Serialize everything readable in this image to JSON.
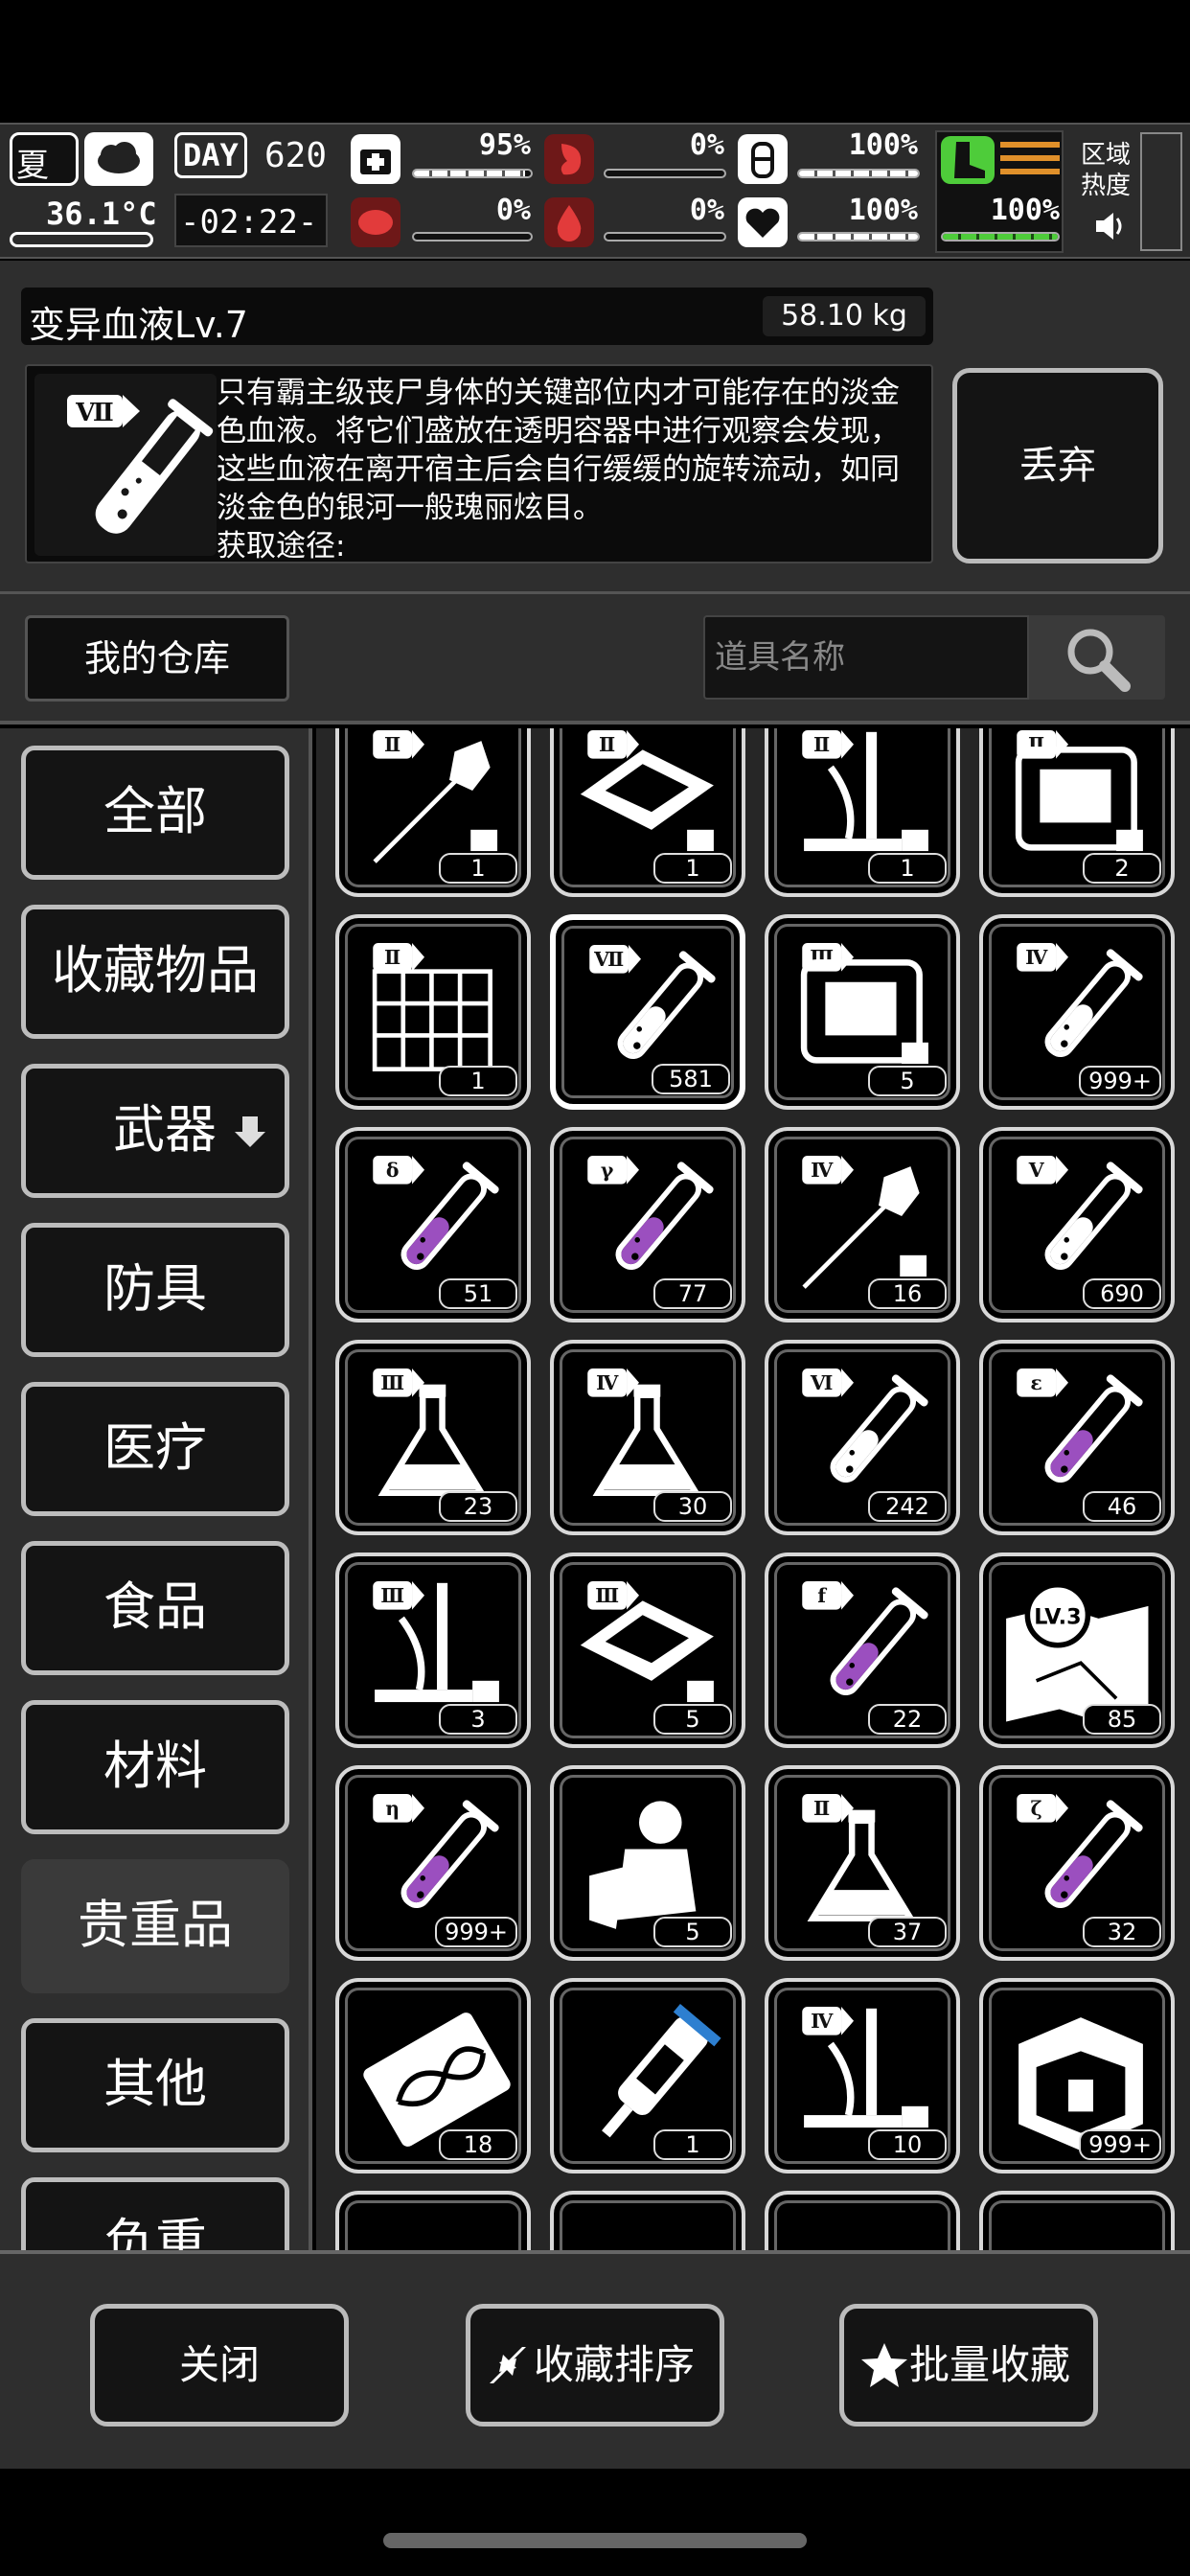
{
  "hud": {
    "season": "夏",
    "day_label": "DAY",
    "day": "620",
    "temperature": "36.1°C",
    "clock": "-02:22-",
    "stats": [
      {
        "name": "health",
        "pct": "95%",
        "level": 0.95
      },
      {
        "name": "hunger",
        "pct": "0%",
        "level": 0.0
      },
      {
        "name": "thirst",
        "pct": "100%",
        "level": 1.0
      },
      {
        "name": "infection",
        "pct": "0%",
        "level": 0.0
      },
      {
        "name": "blood",
        "pct": "0%",
        "level": 0.0
      },
      {
        "name": "mood",
        "pct": "100%",
        "level": 1.0
      },
      {
        "name": "stamina",
        "pct": "100%",
        "level": 1.0
      }
    ],
    "zone_heat_label": "区域热度"
  },
  "item": {
    "name": "变异血液Lv.7",
    "weight": "58.10 kg",
    "tier": "Ⅶ",
    "description": "只有霸主级丧尸身体的关键部位内才可能存在的淡金色血液。将它们盛放在透明容器中进行观察会发现，这些血液在离开宿主后会自行缓缓的旋转流动，如同淡金色的银河一般瑰丽炫目。",
    "source_label": "获取途径:",
    "discard_label": "丢弃"
  },
  "warehouse": {
    "button_label": "我的仓库",
    "search_placeholder": "道具名称"
  },
  "categories": [
    {
      "label": "全部",
      "active": false
    },
    {
      "label": "收藏物品",
      "active": false
    },
    {
      "label": "武器",
      "active": false
    },
    {
      "label": "防具",
      "active": false
    },
    {
      "label": "医疗",
      "active": false
    },
    {
      "label": "食品",
      "active": false
    },
    {
      "label": "材料",
      "active": false
    },
    {
      "label": "贵重品",
      "active": true
    },
    {
      "label": "其他",
      "active": false
    },
    {
      "label": "负重",
      "active": false
    }
  ],
  "items": [
    {
      "icon": "syringe-icon",
      "tier": "Ⅱ",
      "count": "1"
    },
    {
      "icon": "chip-icon",
      "tier": "Ⅱ",
      "count": "1"
    },
    {
      "icon": "lab-stand-icon",
      "tier": "Ⅱ",
      "count": "1"
    },
    {
      "icon": "machine-icon",
      "tier": "Ⅱ",
      "count": "2"
    },
    {
      "icon": "grid-plate-icon",
      "tier": "Ⅱ",
      "count": "1"
    },
    {
      "icon": "test-tube-icon",
      "tier": "Ⅶ",
      "count": "581",
      "selected": true
    },
    {
      "icon": "machine-icon",
      "tier": "Ⅲ",
      "count": "5"
    },
    {
      "icon": "test-tube-icon",
      "tier": "Ⅳ",
      "count": "999+"
    },
    {
      "icon": "test-tube-purple-icon",
      "tier": "δ",
      "count": "51"
    },
    {
      "icon": "test-tube-purple-icon",
      "tier": "γ",
      "count": "77"
    },
    {
      "icon": "syringe-icon",
      "tier": "Ⅳ",
      "count": "16"
    },
    {
      "icon": "test-tube-icon",
      "tier": "Ⅴ",
      "count": "690"
    },
    {
      "icon": "flask-icon",
      "tier": "Ⅲ",
      "count": "23"
    },
    {
      "icon": "flask-icon",
      "tier": "Ⅳ",
      "count": "30"
    },
    {
      "icon": "test-tube-icon",
      "tier": "Ⅵ",
      "count": "242"
    },
    {
      "icon": "test-tube-purple-icon",
      "tier": "ε",
      "count": "46"
    },
    {
      "icon": "lab-stand-icon",
      "tier": "Ⅲ",
      "count": "3"
    },
    {
      "icon": "chip-icon",
      "tier": "Ⅲ",
      "count": "5"
    },
    {
      "icon": "test-tube-purple-icon",
      "tier": "f",
      "count": "22"
    },
    {
      "icon": "map-icon",
      "tier": "LV.3",
      "count": "85"
    },
    {
      "icon": "test-tube-purple-icon",
      "tier": "η",
      "count": "999+"
    },
    {
      "icon": "astronaut-icon",
      "tier": "",
      "count": "5"
    },
    {
      "icon": "flask-icon",
      "tier": "Ⅱ",
      "count": "37"
    },
    {
      "icon": "test-tube-purple-icon",
      "tier": "ζ",
      "count": "32"
    },
    {
      "icon": "dna-card-icon",
      "tier": "",
      "count": "18"
    },
    {
      "icon": "injector-icon",
      "tier": "",
      "count": "1"
    },
    {
      "icon": "lab-stand-icon",
      "tier": "Ⅳ",
      "count": "10"
    },
    {
      "icon": "crate-icon",
      "tier": "",
      "count": "999+"
    }
  ],
  "bottom": {
    "close_label": "关闭",
    "sort_label": "收藏排序",
    "batch_label": "批量收藏"
  },
  "colors": {
    "accent_green": "#4ecc3a",
    "purple_liquid": "#9b4fbf",
    "panel_bg": "#2e2e2e"
  }
}
